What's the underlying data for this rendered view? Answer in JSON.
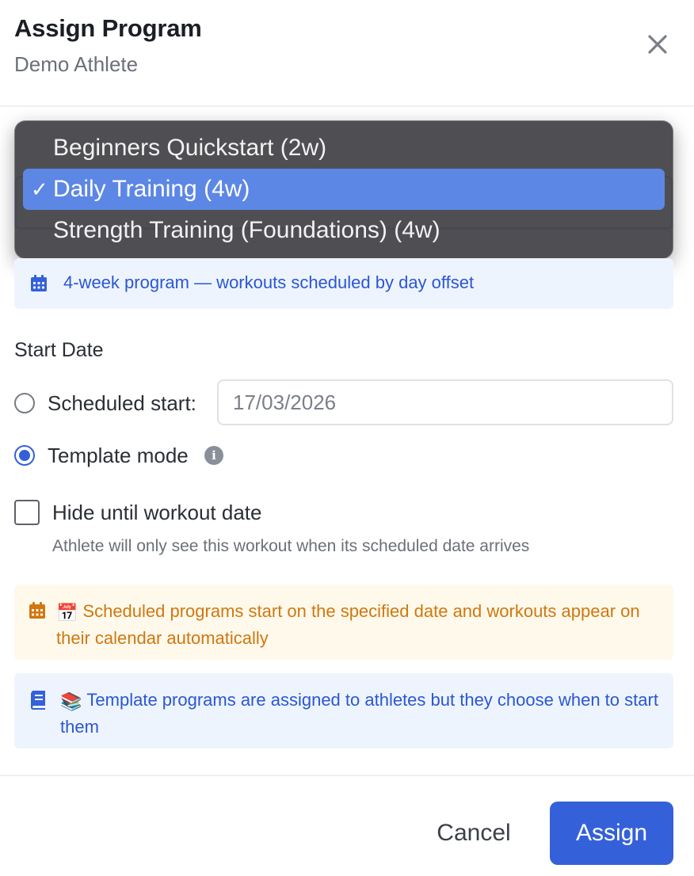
{
  "dialog": {
    "title": "Assign Program",
    "subtitle": "Demo Athlete",
    "close_icon": "close-icon"
  },
  "program_select": {
    "check_mark": "✓",
    "options": [
      {
        "label": "Beginners Quickstart (2w)",
        "selected": false
      },
      {
        "label": "Daily Training (4w)",
        "selected": true
      },
      {
        "label": "Strength Training (Foundations) (4w)",
        "selected": false
      }
    ]
  },
  "program_info": {
    "icon": "calendar-icon",
    "text": "4-week program — workouts scheduled by day offset"
  },
  "start_date": {
    "label": "Start Date",
    "scheduled_label": "Scheduled start:",
    "scheduled_selected": false,
    "date_value": "17/03/2026",
    "template_label": "Template mode",
    "template_selected": true,
    "info_icon_glyph": "i"
  },
  "hide_option": {
    "label": "Hide until workout date",
    "checked": false,
    "help": "Athlete will only see this workout when its scheduled date arrives"
  },
  "scheduled_note": {
    "icon": "calendar-icon",
    "emoji": "📅",
    "text": "Scheduled programs start on the specified date and workouts appear on their calendar automatically"
  },
  "template_note": {
    "icon": "book-icon",
    "emoji": "📚",
    "text": "Template programs are assigned to athletes but they choose when to start them"
  },
  "footer": {
    "cancel_label": "Cancel",
    "assign_label": "Assign"
  },
  "colors": {
    "primary": "#3461d9",
    "selected_option": "#5c87e4",
    "info_blue_bg": "#eef4fe",
    "info_yellow_bg": "#fef9ea",
    "warning_text": "#d07712"
  }
}
